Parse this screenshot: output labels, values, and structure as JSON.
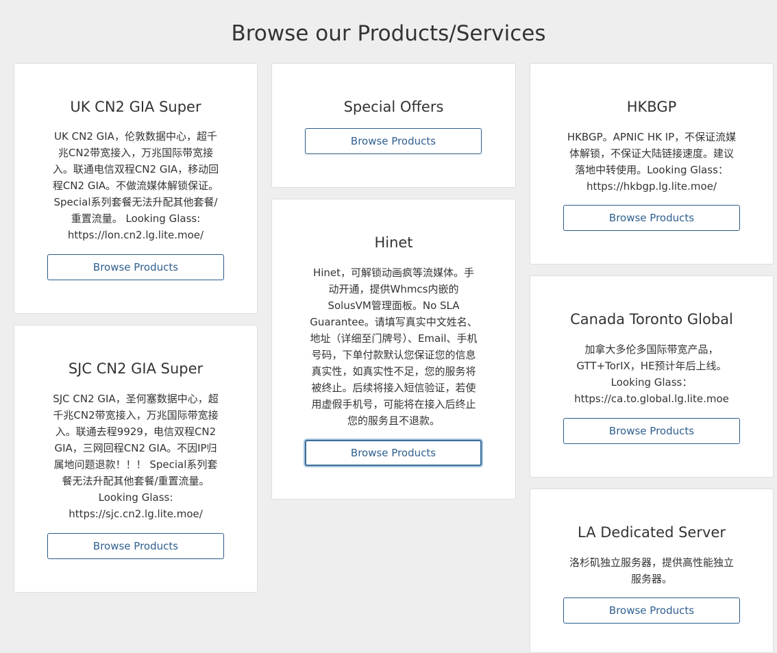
{
  "page": {
    "title": "Browse our Products/Services"
  },
  "cards": {
    "uk": {
      "title": "UK CN2 GIA Super",
      "desc": [
        "UK CN2 GIA，伦敦数据中心，超千",
        "兆CN2带宽接入，万兆国际带宽接",
        "入。联通电信双程CN2 GIA，移动回",
        "程CN2 GIA。不做流媒体解锁保证。",
        "Special系列套餐无法升配其他套餐/",
        "重置流量。 Looking Glass:",
        "https://lon.cn2.lg.lite.moe/"
      ],
      "button": "Browse Products"
    },
    "sjc": {
      "title": "SJC CN2 GIA Super",
      "desc": [
        "SJC CN2 GIA，圣何塞数据中心，超",
        "千兆CN2带宽接入，万兆国际带宽接",
        "入。联通去程9929，电信双程CN2",
        "GIA，三网回程CN2 GIA。不因IP归",
        "属地问题退款！！！ Special系列套",
        "餐无法升配其他套餐/重置流量。",
        "Looking Glass:",
        "https://sjc.cn2.lg.lite.moe/"
      ],
      "button": "Browse Products"
    },
    "special": {
      "title": "Special Offers",
      "button": "Browse Products"
    },
    "hinet": {
      "title": "Hinet",
      "desc": [
        "Hinet，可解锁动画疯等流媒体。手",
        "动开通，提供Whmcs内嵌的",
        "SolusVM管理面板。No SLA",
        "Guarantee。请填写真实中文姓名、",
        "地址（详细至门牌号）、Email、手机",
        "号码，下单付款默认您保证您的信息",
        "真实性，如真实性不足，您的服务将",
        "被终止。后续将接入短信验证，若使",
        "用虚假手机号，可能将在接入后终止",
        "您的服务且不退款。"
      ],
      "button": "Browse Products"
    },
    "hkbgp": {
      "title": "HKBGP",
      "desc": [
        "HKBGP。APNIC HK IP，不保证流媒",
        "体解锁，不保证大陆链接速度。建议",
        "落地中转使用。Looking Glass：",
        "https://hkbgp.lg.lite.moe/"
      ],
      "button": "Browse Products"
    },
    "canada": {
      "title": "Canada Toronto Global",
      "desc": [
        "加拿大多伦多国际带宽产品，",
        "GTT+TorIX，HE预计年后上线。",
        "Looking Glass：",
        "https://ca.to.global.lg.lite.moe"
      ],
      "button": "Browse Products"
    },
    "la": {
      "title": "LA Dedicated Server",
      "desc": [
        "洛杉矶独立服务器，提供高性能独立",
        "服务器。"
      ],
      "button": "Browse Products"
    }
  },
  "colors": {
    "background": "#eeeeee",
    "card": "#ffffff",
    "card_border": "#dddddd",
    "button_border": "#2a5a8a",
    "button_text": "#2f5f8f"
  }
}
